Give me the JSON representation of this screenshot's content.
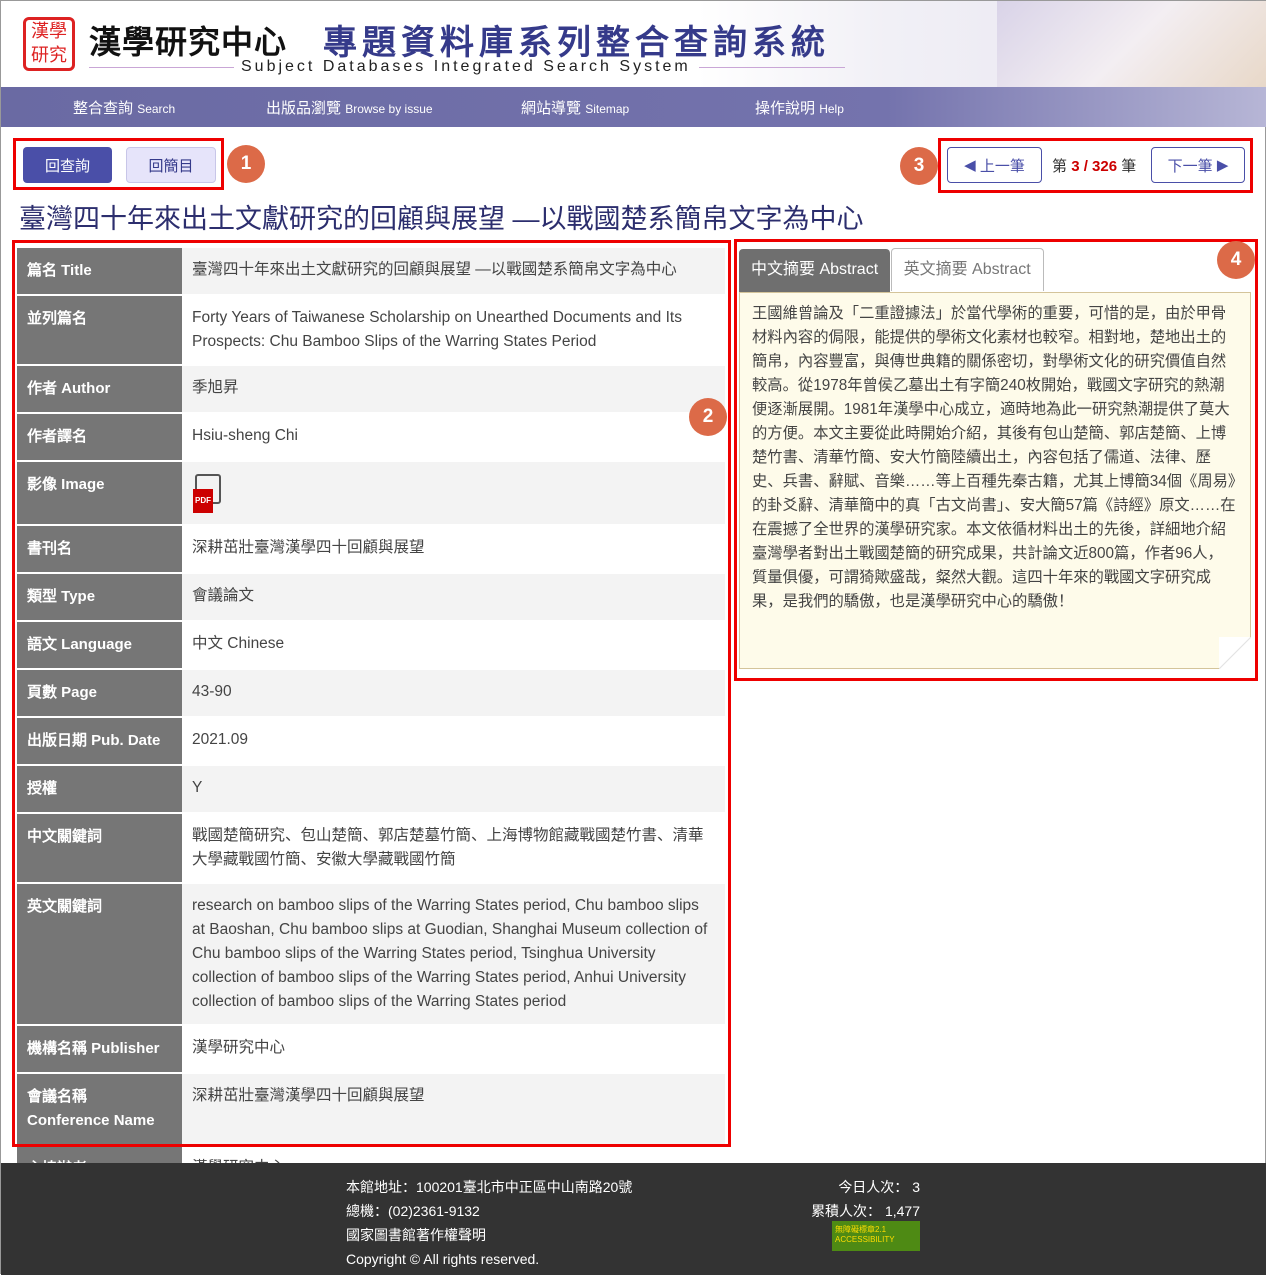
{
  "header": {
    "seal_text": "漢學研究",
    "org_name": "漢學研究中心",
    "system_title": "專題資料庫系列整合查詢系統",
    "system_title_en": "Subject Databases Integrated Search System"
  },
  "nav": [
    {
      "cn": "整合查詢",
      "en": "Search"
    },
    {
      "cn": "出版品瀏覽",
      "en": "Browse by issue"
    },
    {
      "cn": "網站導覽",
      "en": "Sitemap"
    },
    {
      "cn": "操作說明",
      "en": "Help"
    }
  ],
  "controls": {
    "back_search": "回查詢",
    "back_list": "回簡目",
    "prev": "上一筆",
    "next": "下一筆",
    "page_prefix": "第",
    "page_current": "3 / 326",
    "page_suffix": "筆"
  },
  "annotations": [
    "1",
    "2",
    "3",
    "4"
  ],
  "colors": {
    "accent": "#353a8a",
    "nav": "#6a6aa3",
    "annotation": "#dc6a48",
    "highlight_box": "#ee0000"
  },
  "title": "臺灣四十年來出土文獻研究的回顧與展望 —以戰國楚系簡帛文字為中心",
  "fields": [
    {
      "label": "篇名 Title",
      "value": "臺灣四十年來出土文獻研究的回顧與展望 —以戰國楚系簡帛文字為中心"
    },
    {
      "label": "並列篇名",
      "value": "Forty Years of Taiwanese Scholarship on Unearthed Documents and Its Prospects: Chu Bamboo Slips of the Warring States Period"
    },
    {
      "label": "作者 Author",
      "value": "季旭昇"
    },
    {
      "label": "作者譯名",
      "value": "Hsiu-sheng Chi"
    },
    {
      "label": "影像 Image",
      "value": "",
      "icon": "pdf-icon"
    },
    {
      "label": "書刊名",
      "value": "深耕茁壯臺灣漢學四十回顧與展望"
    },
    {
      "label": "類型 Type",
      "value": "會議論文"
    },
    {
      "label": "語文 Language",
      "value": "中文 Chinese"
    },
    {
      "label": "頁數 Page",
      "value": "43-90"
    },
    {
      "label": "出版日期 Pub. Date",
      "value": "2021.09"
    },
    {
      "label": "授權",
      "value": "Y"
    },
    {
      "label": "中文關鍵詞",
      "value": "戰國楚簡研究、包山楚簡、郭店楚墓竹簡、上海博物館藏戰國楚竹書、清華大學藏戰國竹簡、安徽大學藏戰國竹簡"
    },
    {
      "label": "英文關鍵詞",
      "value": "research on bamboo slips of the Warring States period, Chu bamboo slips at Baoshan, Chu bamboo slips at Guodian, Shanghai Museum collection of Chu bamboo slips of the Warring States period, Tsinghua University collection of bamboo slips of the Warring States period, Anhui University collection of bamboo slips of the Warring States period"
    },
    {
      "label": "機構名稱 Publisher",
      "value": "漢學研究中心"
    },
    {
      "label": "會議名稱 Conference Name",
      "value": "深耕茁壯臺灣漢學四十回顧與展望"
    },
    {
      "label": "主協辦者 Sponsors",
      "value": "漢學研究中心"
    }
  ],
  "abstract": {
    "tab_cn": "中文摘要 Abstract",
    "tab_en": "英文摘要 Abstract",
    "text": "王國維曾論及「二重證據法」於當代學術的重要，可惜的是，由於甲骨材料內容的侷限，能提供的學術文化素材也較窄。相對地，楚地出土的簡帛，內容豐富，與傳世典籍的關係密切，對學術文化的研究價值自然較高。從1978年曾侯乙墓出土有字簡240枚開始，戰國文字研究的熱潮便逐漸展開。1981年漢學中心成立，適時地為此一研究熱潮提供了莫大的方便。本文主要從此時開始介紹，其後有包山楚簡、郭店楚簡、上博楚竹書、清華竹簡、安大竹簡陸續出土，內容包括了儒道、法律、歷史、兵書、辭賦、音樂……等上百種先秦古籍，尤其上博簡34個《周易》的卦爻辭、清華簡中的真「古文尚書」、安大簡57篇《詩經》原文……在在震撼了全世界的漢學研究家。本文依循材料出土的先後，詳細地介紹臺灣學者對出土戰國楚簡的研究成果，共計論文近800篇，作者96人，質量俱優，可謂猗歟盛哉，粲然大觀。這四十年來的戰國文字研究成果，是我們的驕傲，也是漢學研究中心的驕傲！"
  },
  "footer": {
    "address": "本館地址：100201臺北市中正區中山南路20號",
    "phone": "總機：(02)2361-9132",
    "copyright_notice": "國家圖書館著作權聲明",
    "copyright": "Copyright © All rights reserved.",
    "today": "今日人次： 3",
    "total": "累積人次： 1,477",
    "accessibility_badge": "無障礙標章2.1 ACCESSIBILITY"
  }
}
